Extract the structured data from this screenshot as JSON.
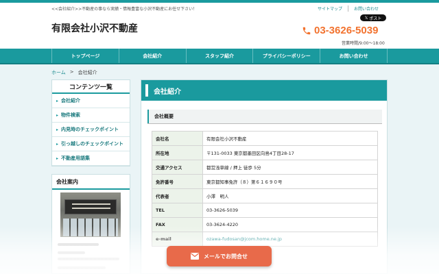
{
  "header": {
    "tagline": "<<会社紹介>>不動産の事なら実績・情報豊富な小沢不動産にお任せ下さい！",
    "links": [
      "サイトマップ",
      "お問い合わせ"
    ],
    "x_post_label": "ポスト",
    "company_name": "有限会社小沢不動産",
    "phone": "03-3626-5039",
    "hours": "営業時間/9:00～18:00"
  },
  "nav": {
    "items": [
      "トップページ",
      "会社紹介",
      "スタッフ紹介",
      "プライバシーポリシー",
      "お問い合わせ"
    ]
  },
  "breadcrumb": {
    "home": "ホーム",
    "separator": ">",
    "current": "会社紹介"
  },
  "sidebar": {
    "contents_title": "コンテンツ一覧",
    "items": [
      "会社紹介",
      "物件検索",
      "内見時のチェックポイント",
      "引っ越しのチェックポイント",
      "不動産用語集"
    ],
    "company_box_title": "会社案内"
  },
  "main": {
    "title": "会社紹介",
    "subtitle": "会社概要",
    "rows": [
      {
        "key": "会社名",
        "value": "有限会社小沢不動産"
      },
      {
        "key": "所在地",
        "value": "〒131-0033 東京都墨田区向島4丁目28-17"
      },
      {
        "key": "交通アクセス",
        "value": "都営浅草線 / 押上 徒歩 5分"
      },
      {
        "key": "免許番号",
        "value": "東京都知事免許（８）第６１６９０号"
      },
      {
        "key": "代表者",
        "value": "小澤　明人"
      },
      {
        "key": "TEL",
        "value": "03-3626-5039"
      },
      {
        "key": "FAX",
        "value": "03-3624-4220"
      },
      {
        "key": "e-mail",
        "value": "ozawa-fudosan@jcom.home.ne.jp"
      }
    ]
  },
  "contact_button": {
    "label": "メールでお問合せ"
  },
  "colors": {
    "accent": "#1a9a9e",
    "phone": "#f2722e",
    "contact_button": "#e86a4a"
  }
}
